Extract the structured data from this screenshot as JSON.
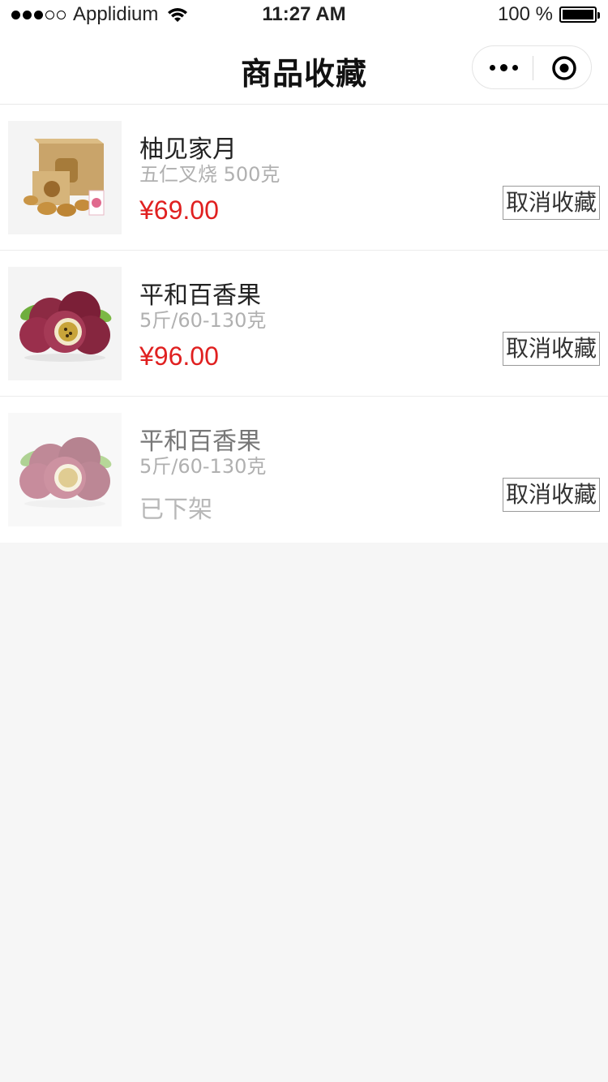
{
  "status_bar": {
    "carrier": "Applidium",
    "time": "11:27 AM",
    "battery": "100 %"
  },
  "nav": {
    "title": "商品收藏"
  },
  "items": [
    {
      "name": "柚见家月",
      "spec": "五仁叉烧 500克",
      "price": "¥69.00",
      "status": "",
      "button": "取消收藏"
    },
    {
      "name": "平和百香果",
      "spec": "5斤/60-130克",
      "price": "¥96.00",
      "status": "",
      "button": "取消收藏"
    },
    {
      "name": "平和百香果",
      "spec": "5斤/60-130克",
      "price": "",
      "status": "已下架",
      "button": "取消收藏"
    }
  ],
  "colors": {
    "price": "#e02020",
    "background": "#f6f6f6"
  },
  "icons": [
    "wifi-icon",
    "battery-icon",
    "more-icon",
    "target-icon"
  ]
}
